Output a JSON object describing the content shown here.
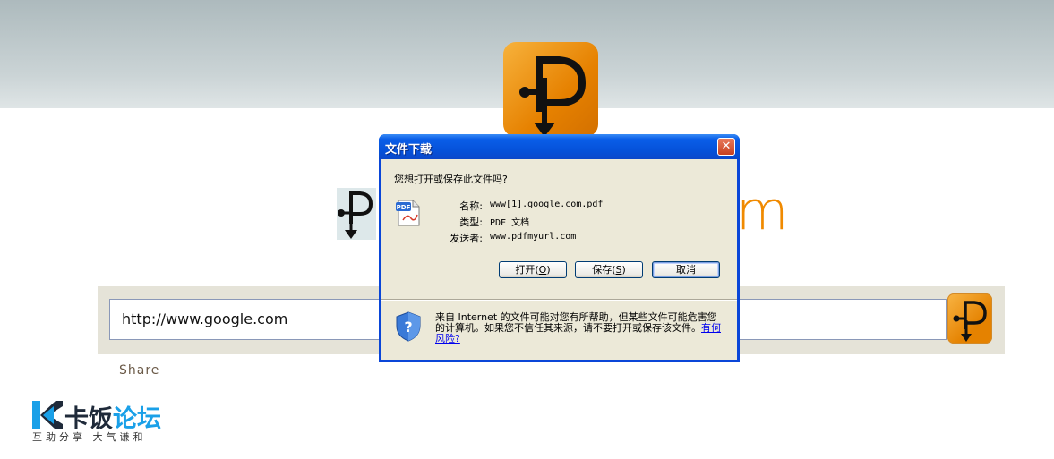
{
  "page": {
    "url_value": "http://www.google.com",
    "share_label": "Share",
    "brand_fragment": "m"
  },
  "watermark": {
    "title_left": "卡饭",
    "title_right": "论坛",
    "subtitle": "互助分享 大气谦和"
  },
  "dialog": {
    "title": "文件下载",
    "close_glyph": "✕",
    "question": "您想打开或保存此文件吗?",
    "file_icon": "pdf-document-icon",
    "file_icon_text": "PDF",
    "labels": {
      "name": "名称:",
      "type": "类型:",
      "sender": "发送者:"
    },
    "values": {
      "name": "www[1].google.com.pdf",
      "type": "PDF 文档",
      "sender": "www.pdfmyurl.com"
    },
    "buttons": {
      "open": "打开",
      "open_key": "O",
      "save": "保存",
      "save_key": "S",
      "cancel": "取消"
    },
    "warning_text": "来自 Internet 的文件可能对您有所帮助，但某些文件可能危害您的计算机。如果您不信任其来源，请不要打开或保存该文件。",
    "risk_link": "有何风险?"
  },
  "icons": [
    "pdfmyurl-logo-icon",
    "pdf-document-icon",
    "security-shield-icon",
    "close-icon"
  ],
  "colors": {
    "brand_orange": "#e68100",
    "titlebar_blue": "#0550d8",
    "dialog_face": "#ece9d8",
    "link": "#0000ee"
  }
}
